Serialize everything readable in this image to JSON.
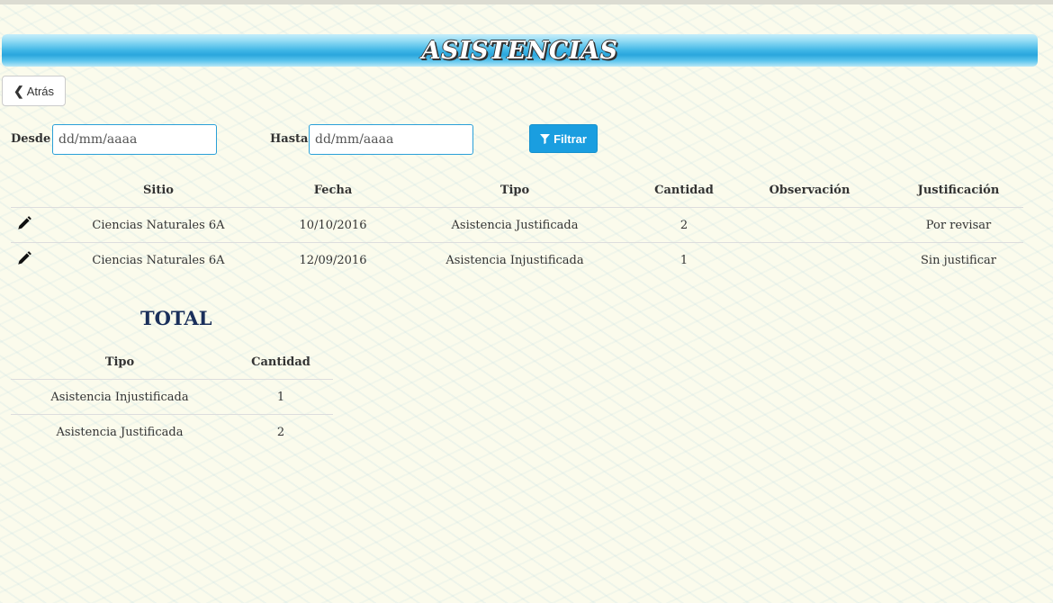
{
  "header": {
    "title": "ASISTENCIAS"
  },
  "back_button": {
    "icon": "chevron-left-icon",
    "label": "Atrás"
  },
  "filters": {
    "desde_label": "Desde",
    "hasta_label": "Hasta",
    "desde_placeholder": "dd/mm/aaaa",
    "hasta_placeholder": "dd/mm/aaaa",
    "filter_button_label": "Filtrar",
    "filter_icon": "filter-icon"
  },
  "attendance_table": {
    "columns": [
      "Sitio",
      "Fecha",
      "Tipo",
      "Cantidad",
      "Observación",
      "Justificación"
    ],
    "rows": [
      {
        "sitio": "Ciencias Naturales 6A",
        "fecha": "10/10/2016",
        "tipo": "Asistencia Justificada",
        "cantidad": "2",
        "observacion": "",
        "justificacion": "Por revisar"
      },
      {
        "sitio": "Ciencias Naturales 6A",
        "fecha": "12/09/2016",
        "tipo": "Asistencia Injustificada",
        "cantidad": "1",
        "observacion": "",
        "justificacion": "Sin justificar"
      }
    ]
  },
  "total": {
    "title": "TOTAL",
    "columns": [
      "Tipo",
      "Cantidad"
    ],
    "rows": [
      {
        "tipo": "Asistencia Injustificada",
        "cantidad": "1"
      },
      {
        "tipo": "Asistencia Justificada",
        "cantidad": "2"
      }
    ]
  },
  "colors": {
    "accent": "#1a9ee0",
    "title": "#1a2f5a"
  }
}
